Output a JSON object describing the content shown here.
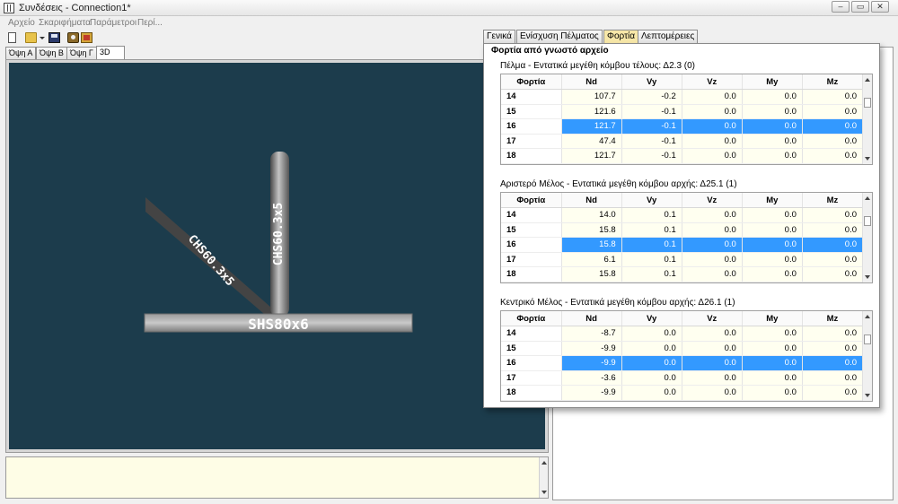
{
  "window": {
    "title": "Συνδέσεις - Connection1*"
  },
  "menu": [
    "Αρχείο",
    "Σκαριφήματα",
    "Παράμετροι",
    "Περί..."
  ],
  "view_tabs": [
    "Όψη Α",
    "Όψη Β",
    "Όψη Γ",
    "3D"
  ],
  "scene": {
    "base_label": "SHS80x6",
    "diagonal_label": "CHS60.3x5",
    "vertical_label": "CHS60.3x5",
    "background": "#1c3c4c"
  },
  "right_tabs": [
    "Γενικά",
    "Ενίσχυση Πέλματος",
    "Φορτία",
    "Λεπτομέρειες"
  ],
  "panel": {
    "title": "Φορτία από γνωστό αρχείο",
    "columns": [
      "Φορτία",
      "Nd",
      "Vy",
      "Vz",
      "My",
      "Mz"
    ],
    "groups": [
      {
        "title": "Πέλμα - Εντατικά μεγέθη κόμβου τέλους: Δ2.3 (0)",
        "rows": [
          [
            "14",
            "107.7",
            "-0.2",
            "0.0",
            "0.0",
            "0.0"
          ],
          [
            "15",
            "121.6",
            "-0.1",
            "0.0",
            "0.0",
            "0.0"
          ],
          [
            "16",
            "121.7",
            "-0.1",
            "0.0",
            "0.0",
            "0.0"
          ],
          [
            "17",
            "47.4",
            "-0.1",
            "0.0",
            "0.0",
            "0.0"
          ],
          [
            "18",
            "121.7",
            "-0.1",
            "0.0",
            "0.0",
            "0.0"
          ]
        ]
      },
      {
        "title": "Αριστερό Μέλος - Εντατικά μεγέθη κόμβου αρχής: Δ25.1 (1)",
        "rows": [
          [
            "14",
            "14.0",
            "0.1",
            "0.0",
            "0.0",
            "0.0"
          ],
          [
            "15",
            "15.8",
            "0.1",
            "0.0",
            "0.0",
            "0.0"
          ],
          [
            "16",
            "15.8",
            "0.1",
            "0.0",
            "0.0",
            "0.0"
          ],
          [
            "17",
            "6.1",
            "0.1",
            "0.0",
            "0.0",
            "0.0"
          ],
          [
            "18",
            "15.8",
            "0.1",
            "0.0",
            "0.0",
            "0.0"
          ]
        ]
      },
      {
        "title": "Κεντρικό Μέλος - Εντατικά μεγέθη κόμβου αρχής: Δ26.1 (1)",
        "rows": [
          [
            "14",
            "-8.7",
            "0.0",
            "0.0",
            "0.0",
            "0.0"
          ],
          [
            "15",
            "-9.9",
            "0.0",
            "0.0",
            "0.0",
            "0.0"
          ],
          [
            "16",
            "-9.9",
            "0.0",
            "0.0",
            "0.0",
            "0.0"
          ],
          [
            "17",
            "-3.6",
            "0.0",
            "0.0",
            "0.0",
            "0.0"
          ],
          [
            "18",
            "-9.9",
            "0.0",
            "0.0",
            "0.0",
            "0.0"
          ]
        ]
      }
    ],
    "selected_row": "16"
  },
  "colors": {
    "selection": "#3399ff",
    "cell_bg": "#fffff0",
    "notes_bg": "#fefde6",
    "active_tab": "#f7e7a8"
  }
}
